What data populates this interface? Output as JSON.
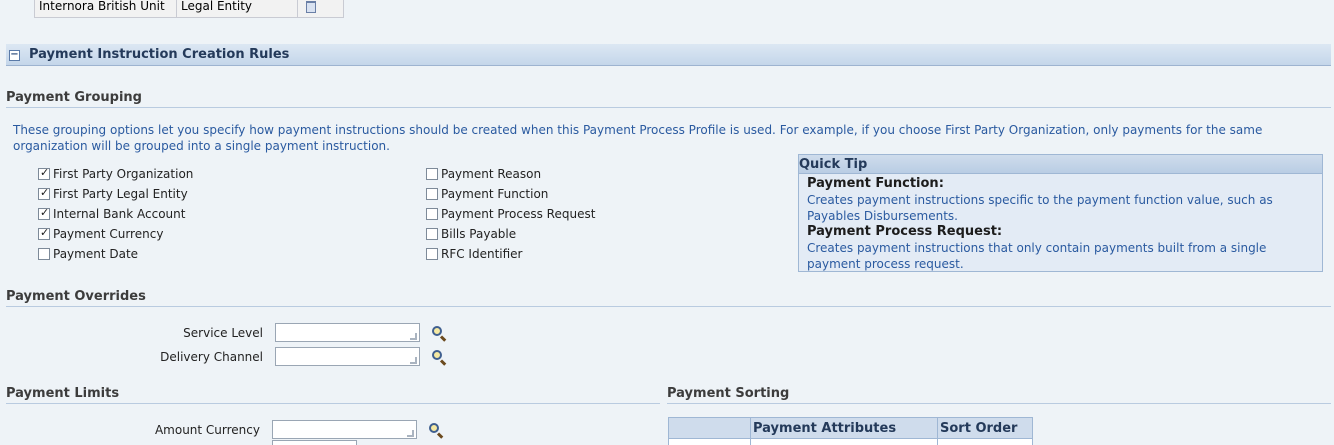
{
  "top_table": {
    "cell1": "Internora British Unit",
    "cell2": "Legal Entity"
  },
  "section": {
    "title": "Payment Instruction Creation Rules",
    "collapse_glyph": "−"
  },
  "payment_grouping": {
    "heading": "Payment Grouping",
    "description": "These grouping options let you specify how payment instructions should be created when this Payment Process Profile is used. For example, if you choose First Party Organization, only payments for the same organization will be grouped into a single payment instruction.",
    "left_options": [
      {
        "label": "First Party Organization",
        "checked": true
      },
      {
        "label": "First Party Legal Entity",
        "checked": true
      },
      {
        "label": "Internal Bank Account",
        "checked": true
      },
      {
        "label": "Payment Currency",
        "checked": true
      },
      {
        "label": "Payment Date",
        "checked": false
      }
    ],
    "right_options": [
      {
        "label": "Payment Reason",
        "checked": false
      },
      {
        "label": "Payment Function",
        "checked": false
      },
      {
        "label": "Payment Process Request",
        "checked": false
      },
      {
        "label": "Bills Payable",
        "checked": false
      },
      {
        "label": "RFC Identifier",
        "checked": false
      }
    ]
  },
  "quick_tip": {
    "title": "Quick Tip",
    "items": [
      {
        "term": "Payment Function:",
        "desc": "Creates payment instructions specific to the payment function value, such as Payables Disbursements."
      },
      {
        "term": "Payment Process Request:",
        "desc": "Creates payment instructions that only contain payments built from a single payment process request."
      }
    ]
  },
  "payment_overrides": {
    "heading": "Payment Overrides",
    "service_level_label": "Service Level",
    "service_level_value": "",
    "delivery_channel_label": "Delivery Channel",
    "delivery_channel_value": ""
  },
  "payment_limits": {
    "heading": "Payment Limits",
    "amount_currency_label": "Amount Currency",
    "amount_currency_value": ""
  },
  "payment_sorting": {
    "heading": "Payment Sorting",
    "columns": [
      "",
      "Payment Attributes",
      "Sort Order"
    ]
  },
  "colors": {
    "link_text": "#2a5aa0",
    "header_bg": "#c4d6ea",
    "page_bg": "#eef3f7"
  }
}
